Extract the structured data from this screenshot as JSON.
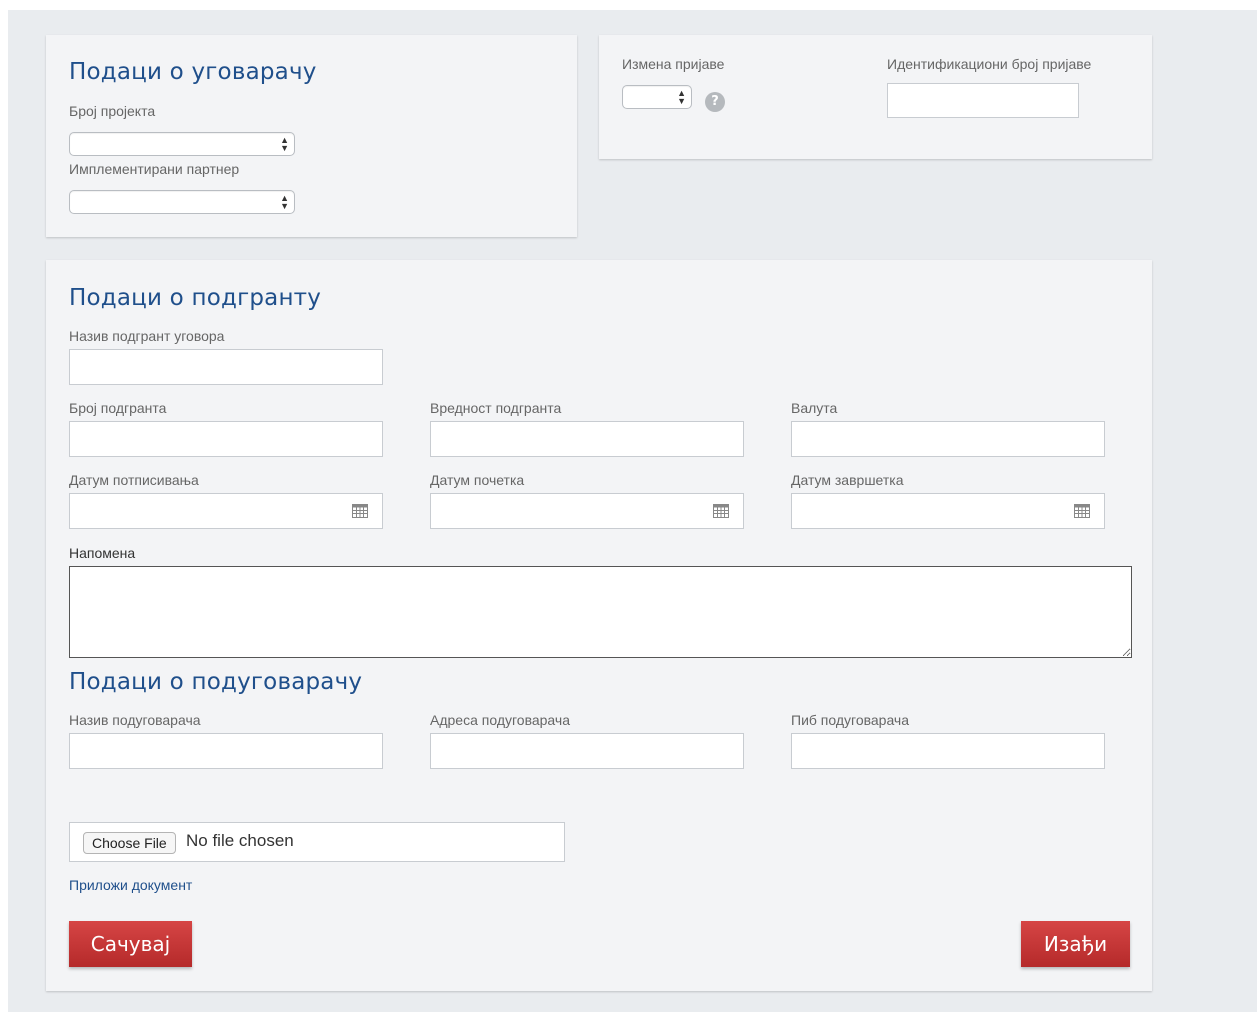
{
  "contractor": {
    "title": "Подаци о уговарачу",
    "project_number_label": "Број пројекта",
    "project_number_value": "",
    "partner_label": "Имплементирани партнер",
    "partner_value": ""
  },
  "application": {
    "change_label": "Измена пријаве",
    "change_value": "",
    "help_glyph": "?",
    "id_label": "Идентификациони број пријаве",
    "id_value": ""
  },
  "subgrant": {
    "title": "Подаци о подгранту",
    "contract_name_label": "Назив подгрант уговора",
    "contract_name_value": "",
    "number_label": "Број подгранта",
    "number_value": "",
    "value_label": "Вредност подгранта",
    "value_value": "",
    "currency_label": "Валута",
    "currency_value": "",
    "sign_date_label": "Датум потписивања",
    "sign_date_value": "",
    "start_date_label": "Датум почетка",
    "start_date_value": "",
    "end_date_label": "Датум завршетка",
    "end_date_value": "",
    "note_label": "Напомена",
    "note_value": ""
  },
  "subcontractor": {
    "title": "Подаци о подуговарачу",
    "name_label": "Назив подуговарача",
    "name_value": "",
    "address_label": "Адреса подуговарача",
    "address_value": "",
    "pib_label": "Пиб подуговарача",
    "pib_value": ""
  },
  "attachment": {
    "choose_file_label": "Choose File",
    "file_status": "No file chosen",
    "attach_link": "Приложи документ"
  },
  "actions": {
    "save_label": "Сачувај",
    "exit_label": "Изађи"
  },
  "icons": {
    "select": "updown-arrows-icon",
    "date": "calendar-icon",
    "help": "question-icon"
  },
  "colors": {
    "title_blue": "#1f4f8b",
    "button_red": "#c43535",
    "panel_bg": "#f3f4f6",
    "page_bg": "#e9ecef"
  }
}
